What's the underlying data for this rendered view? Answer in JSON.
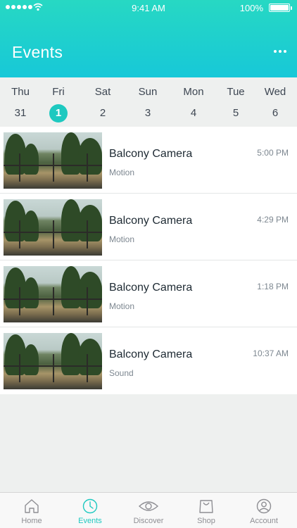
{
  "status_bar": {
    "time": "9:41 AM",
    "battery": "100%"
  },
  "header": {
    "title": "Events",
    "more_icon": "more-icon"
  },
  "colors": {
    "accent": "#1ec9c0",
    "header_top": "#27d8c3",
    "header_bottom": "#17c8d8"
  },
  "dates": [
    {
      "name": "Thu",
      "num": "31",
      "selected": false
    },
    {
      "name": "Fri",
      "num": "1",
      "selected": true
    },
    {
      "name": "Sat",
      "num": "2",
      "selected": false
    },
    {
      "name": "Sun",
      "num": "3",
      "selected": false
    },
    {
      "name": "Mon",
      "num": "4",
      "selected": false
    },
    {
      "name": "Tue",
      "num": "5",
      "selected": false
    },
    {
      "name": "Wed",
      "num": "6",
      "selected": false
    }
  ],
  "events": [
    {
      "camera": "Balcony Camera",
      "type": "Motion",
      "time": "5:00 PM"
    },
    {
      "camera": "Balcony Camera",
      "type": "Motion",
      "time": "4:29 PM"
    },
    {
      "camera": "Balcony Camera",
      "type": "Motion",
      "time": "1:18 PM"
    },
    {
      "camera": "Balcony Camera",
      "type": "Sound",
      "time": "10:37 AM"
    }
  ],
  "tabs": [
    {
      "label": "Home",
      "icon": "home-icon",
      "active": false
    },
    {
      "label": "Events",
      "icon": "clock-icon",
      "active": true
    },
    {
      "label": "Discover",
      "icon": "eye-icon",
      "active": false
    },
    {
      "label": "Shop",
      "icon": "shopping-bag-icon",
      "active": false
    },
    {
      "label": "Account",
      "icon": "user-icon",
      "active": false
    }
  ]
}
